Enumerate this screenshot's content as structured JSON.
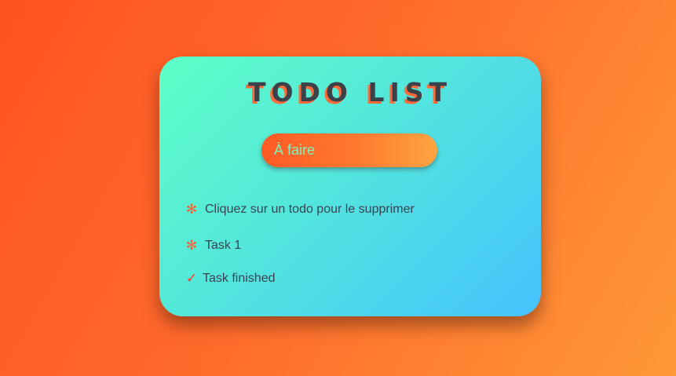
{
  "app": {
    "title": "TODO LIST"
  },
  "input": {
    "placeholder": "À faire"
  },
  "todos": [
    {
      "text": "Cliquez sur un todo pour le supprimer",
      "status": "pending",
      "icon": "asterisk-icon",
      "glyph": "✻"
    },
    {
      "text": "Task 1",
      "status": "pending",
      "icon": "asterisk-icon",
      "glyph": "✻"
    },
    {
      "text": "Task finished",
      "status": "done",
      "icon": "checkmark-icon",
      "glyph": "✓"
    }
  ],
  "colors": {
    "background_start": "#ff5322",
    "background_end": "#ff9838",
    "card_start": "#5effc6",
    "card_end": "#45c3ff",
    "title": "#3b4249",
    "title_shadow": "#ff6a3a",
    "accent": "#ff5a2e",
    "input_text": "#7df2c0"
  }
}
